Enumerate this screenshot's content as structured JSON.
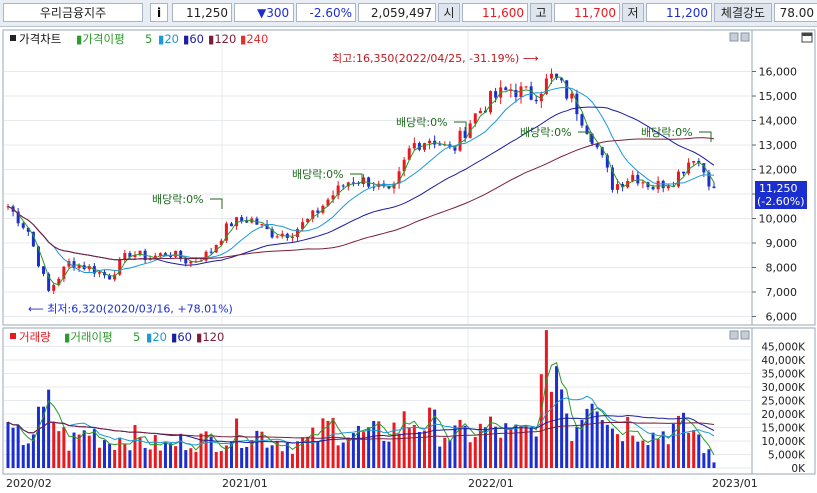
{
  "header": {
    "stock_name": "우리금융지주",
    "info_icon": "i",
    "price": "11,250",
    "change": "▼300",
    "change_pct": "-2.60%",
    "volume": "2,059,497",
    "open_label": "시",
    "open": "11,600",
    "high_label": "고",
    "high": "11,700",
    "low_label": "저",
    "low": "11,200",
    "strength_label": "체결강도",
    "strength": "78.00"
  },
  "price_panel": {
    "legend": {
      "title": "가격차트",
      "ma_label": "가격이평",
      "ma_periods": [
        "5",
        "20",
        "60",
        "120",
        "240"
      ]
    },
    "current_tag": [
      "11,250",
      "(-2.60%)"
    ],
    "annotations": {
      "high": "최고:16,350(2022/04/25, -31.19%)",
      "low": "최저:6,320(2020/03/16, +78.01%)",
      "dividend": "배당락:0%"
    },
    "y_ticks": [
      "16,000",
      "15,000",
      "14,000",
      "13,000",
      "12,000",
      "11,000",
      "10,000",
      "9,000",
      "8,000",
      "7,000",
      "6,000"
    ]
  },
  "volume_panel": {
    "legend": {
      "title": "거래량",
      "ma_label": "거래이평",
      "ma_periods": [
        "5",
        "20",
        "60",
        "120"
      ]
    },
    "y_ticks": [
      "45,000K",
      "40,000K",
      "35,000K",
      "30,000K",
      "25,000K",
      "20,000K",
      "15,000K",
      "10,000K",
      "5,000K",
      "0K"
    ]
  },
  "x_ticks": [
    "2020/02",
    "2021/01",
    "2022/01",
    "2023/01"
  ],
  "colors": {
    "up": "#e8191f",
    "down": "#1b2fd0",
    "ma5": "#2c9a2c",
    "ma20": "#1c9ad6",
    "ma60": "#1c1ca0",
    "ma120": "#7a1f3a",
    "ma240": "#e03030"
  },
  "chart_data": {
    "type": "candlestick",
    "x_range": [
      "2020-01",
      "2023-01"
    ],
    "price_ylim": [
      6000,
      16500
    ],
    "volume_ylim_k": [
      0,
      48000
    ],
    "series": [
      {
        "name": "price_close",
        "period": "2020-01..2023-01",
        "sampled_values": [
          10500,
          9500,
          7000,
          8200,
          8000,
          7600,
          8600,
          8400,
          8600,
          8200,
          8600,
          9800,
          10000,
          9400,
          9400,
          10000,
          10900,
          11600,
          11500,
          10900,
          13000,
          13300,
          12700,
          14100,
          14900,
          15300,
          15000,
          15800,
          14800,
          13300,
          11300,
          11800,
          11300,
          11600,
          12600,
          11250
        ]
      },
      {
        "name": "volume_k",
        "period": "2020-01..2023-01",
        "sampled_values": [
          12000,
          11000,
          22000,
          9000,
          14000,
          10000,
          12000,
          9000,
          8000,
          11000,
          10000,
          12000,
          14000,
          11000,
          9000,
          10000,
          16000,
          13000,
          12000,
          14000,
          18000,
          16000,
          12000,
          13000,
          15000,
          12000,
          14000,
          45000,
          13000,
          35000,
          14000,
          17000,
          12000,
          15000,
          14000,
          2059
        ]
      }
    ],
    "high": {
      "value": 16350,
      "date": "2022/04/25",
      "pct": "-31.19%"
    },
    "low": {
      "value": 6320,
      "date": "2020/03/16",
      "pct": "+78.01%"
    },
    "last": {
      "value": 11250,
      "change_pct": "-2.60%"
    }
  }
}
